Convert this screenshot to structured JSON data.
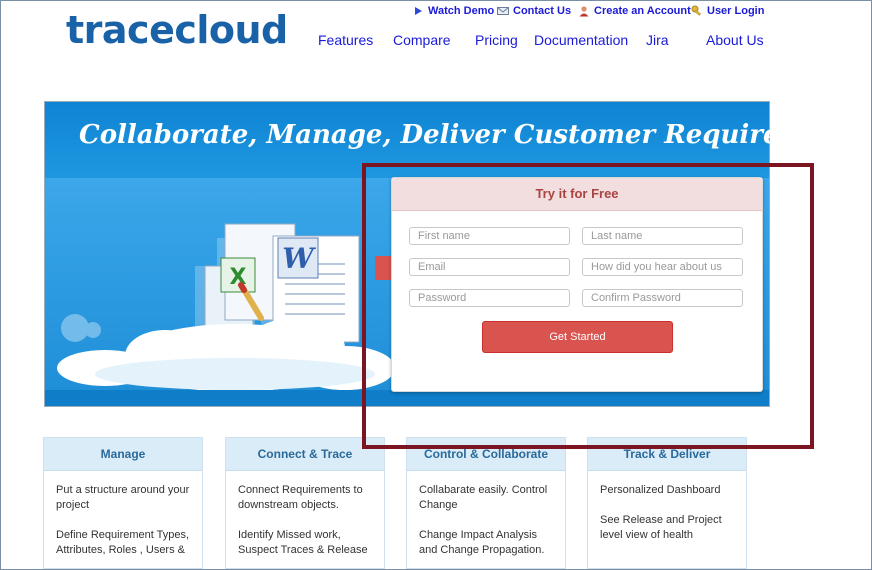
{
  "brand": {
    "logo_text": "tracecloud",
    "logo_color": "#1a62a8"
  },
  "top_links": [
    {
      "label": "Watch Demo",
      "icon": "play-icon"
    },
    {
      "label": "Contact Us",
      "icon": "envelope-icon"
    },
    {
      "label": "Create an Account",
      "icon": "user-icon"
    },
    {
      "label": "User Login",
      "icon": "key-icon"
    }
  ],
  "main_nav": [
    "Features",
    "Compare",
    "Pricing",
    "Documentation",
    "Jira",
    "About Us"
  ],
  "banner": {
    "headline": "Collaborate, Manage, Deliver Customer Requirements"
  },
  "signup_form": {
    "title": "Try it for Free",
    "first_name_placeholder": "First name",
    "last_name_placeholder": "Last name",
    "email_placeholder": "Email",
    "referral_placeholder": "How did you hear about us",
    "password_placeholder": "Password",
    "confirm_password_placeholder": "Confirm Password",
    "submit_label": "Get Started",
    "submit_color": "#d9534f"
  },
  "feature_cards": [
    {
      "title": "Manage",
      "lines": [
        "Put a structure around your project",
        "Define Requirement Types, Attributes, Roles , Users &"
      ]
    },
    {
      "title": "Connect & Trace",
      "lines": [
        "Connect Requirements to downstream objects.",
        "Identify Missed work, Suspect Traces & Release"
      ]
    },
    {
      "title": "Control & Collaborate",
      "lines": [
        "Collabarate easily. Control Change",
        "Change Impact Analysis and Change Propagation."
      ]
    },
    {
      "title": "Track & Deliver",
      "lines": [
        "Personalized Dashboard",
        "See Release and Project level view of health"
      ]
    }
  ],
  "highlight_color": "#7b1521"
}
